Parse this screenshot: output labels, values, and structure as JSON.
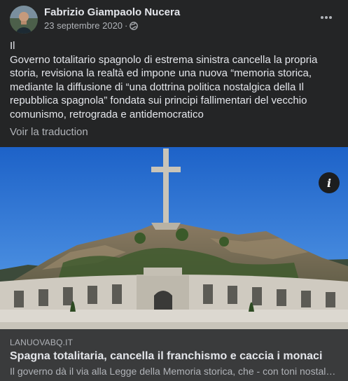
{
  "post": {
    "author": "Fabrizio Giampaolo Nucera",
    "date": "23 septembre 2020",
    "separator": "·",
    "audience_icon": "globe-icon",
    "more_icon": "more-horizontal-icon",
    "text_lines": [
      "Il",
      "Governo  totalitario spagnolo di estrema sinistra cancella la propria storia, revisiona la realtà ed impone una nuova “memoria storica, mediante la diffusione di “una dottrina politica nostalgica della Il repubblica spagnola” fondata sui principi fallimentari del vecchio comunismo, retrograda e antidemocratico"
    ],
    "translate_label": "Voir la traduction"
  },
  "link_preview": {
    "image_description_icon": "info-icon",
    "info_glyph": "i",
    "domain": "LANUOVABQ.IT",
    "title": "Spagna totalitaria, cancella il franchismo e caccia i monaci",
    "description": "Il governo dà il via alla Legge della Memoria storica, che - con toni nostalgici"
  },
  "colors": {
    "background": "#242526",
    "text_primary": "#e4e6eb",
    "text_secondary": "#b0b3b8",
    "link_box": "#3a3b3c"
  }
}
